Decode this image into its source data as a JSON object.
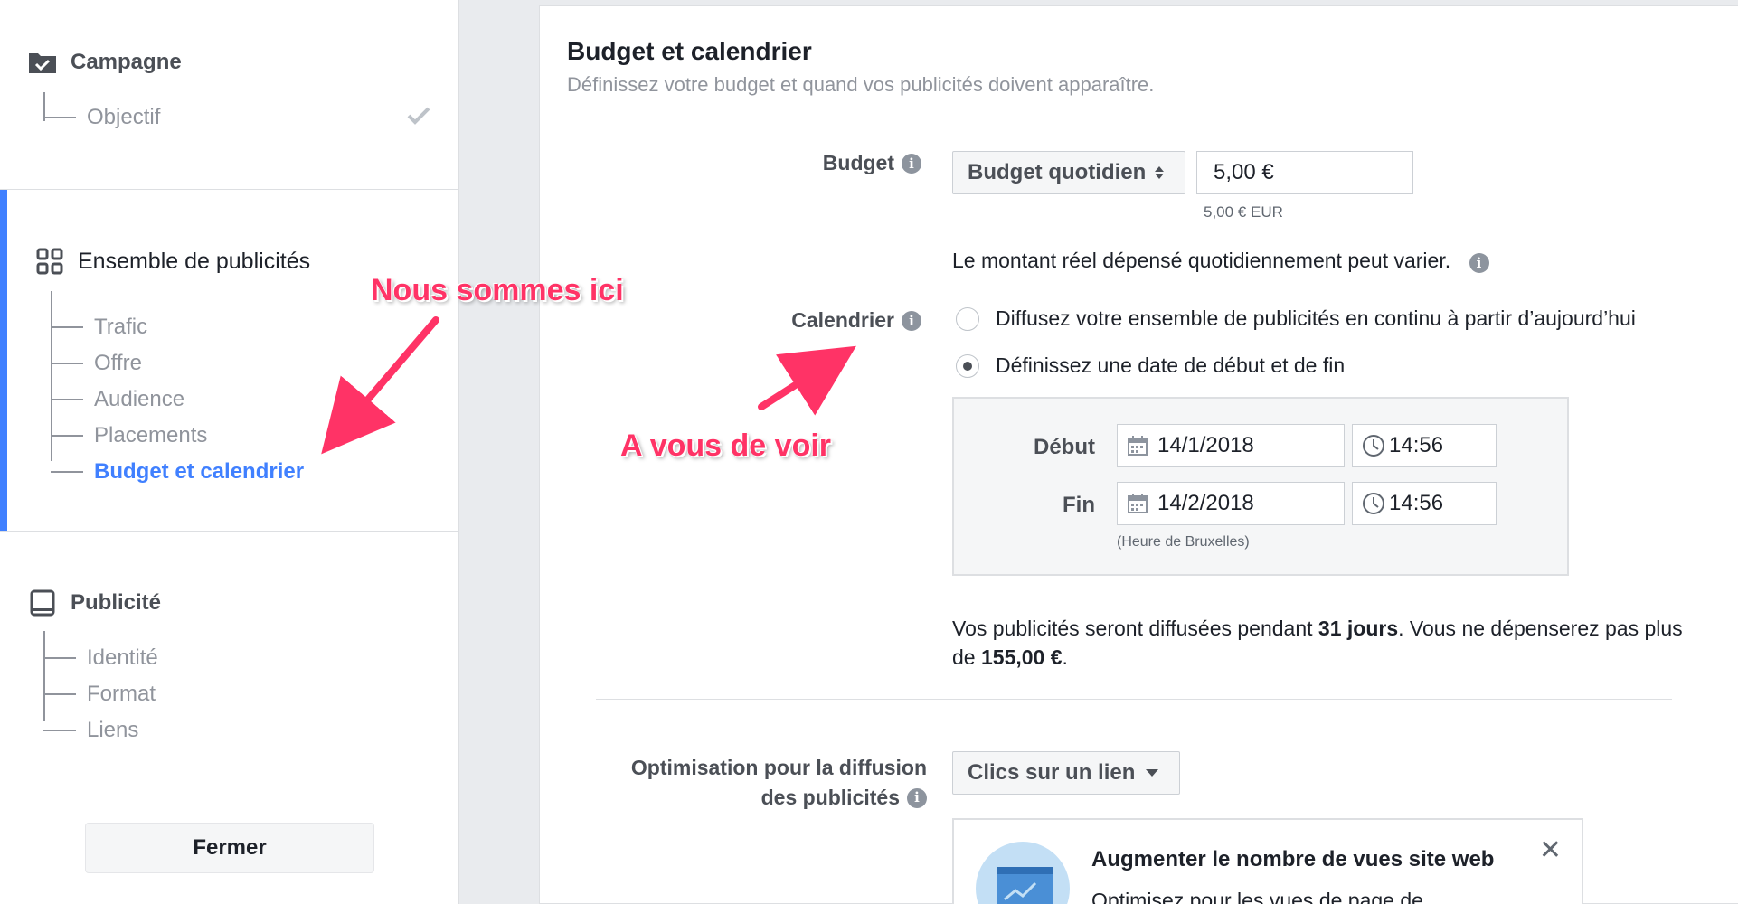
{
  "sidebar": {
    "campaign": {
      "label": "Campagne",
      "items": [
        {
          "label": "Objectif",
          "done": true
        }
      ]
    },
    "adset": {
      "label": "Ensemble de publicités",
      "items": [
        {
          "label": "Trafic"
        },
        {
          "label": "Offre"
        },
        {
          "label": "Audience"
        },
        {
          "label": "Placements"
        },
        {
          "label": "Budget et calendrier",
          "active": true
        }
      ]
    },
    "ad": {
      "label": "Publicité",
      "items": [
        {
          "label": "Identité"
        },
        {
          "label": "Format"
        },
        {
          "label": "Liens"
        }
      ]
    },
    "close_label": "Fermer"
  },
  "main": {
    "title": "Budget et calendrier",
    "subtitle": "Définissez votre budget et quand vos publicités doivent apparaître.",
    "budget": {
      "label": "Budget",
      "type_select": "Budget quotidien",
      "amount": "5,00 €",
      "amount_note": "5,00 € EUR",
      "variation_note": "Le montant réel dépensé quotidiennement peut varier."
    },
    "schedule": {
      "label": "Calendrier",
      "option_continuous": "Diffusez votre ensemble de publicités en continu à partir d’aujourd’hui",
      "option_dates": "Définissez une date de début et de fin",
      "selected": "dates",
      "start_label": "Début",
      "start_date": "14/1/2018",
      "start_time": "14:56",
      "end_label": "Fin",
      "end_date": "14/2/2018",
      "end_time": "14:56",
      "timezone": "(Heure de Bruxelles)"
    },
    "summary": {
      "part1": "Vos publicités seront diffusées pendant ",
      "days": "31 jours",
      "part2": ". Vous ne dépenserez pas plus de ",
      "max": "155,00 €",
      "part3": "."
    },
    "optimization": {
      "label_line1": "Optimisation pour la diffusion",
      "label_line2": "des publicités",
      "select": "Clics sur un lien"
    },
    "tip_card": {
      "title": "Augmenter le nombre de vues site web",
      "text": "Optimisez pour les vues de page de"
    }
  },
  "annotations": {
    "here": "Nous sommes ici",
    "see": "A vous de voir"
  },
  "colors": {
    "accent": "#4080ff",
    "annotation": "#ff3366",
    "muted": "#90949c"
  }
}
